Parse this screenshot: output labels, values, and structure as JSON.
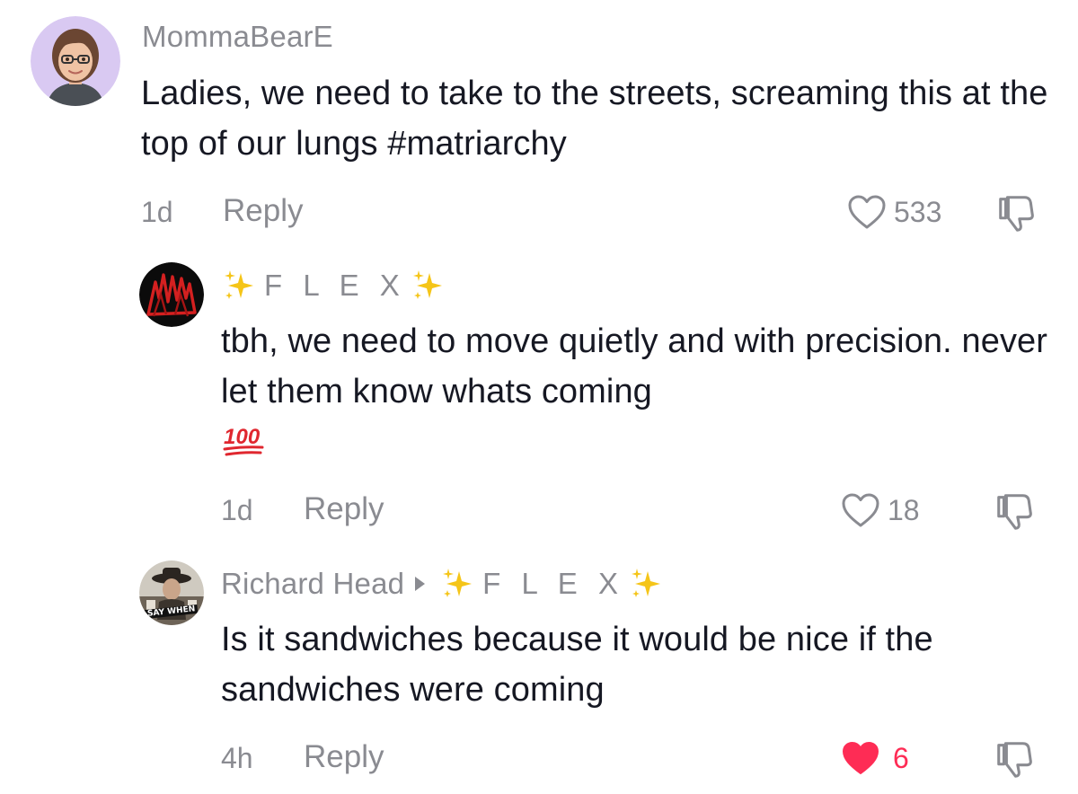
{
  "comments": [
    {
      "username": "MommaBearE",
      "text": "Ladies, we need to take to the streets, screaming this at the top of our lungs #matriarchy",
      "time": "1d",
      "reply_label": "Reply",
      "likes": "533",
      "liked": false
    },
    {
      "username": "F L E X",
      "text": "tbh, we need to move quietly and with precision. never let them know whats coming",
      "emoji": "hundred-points-emoji",
      "time": "1d",
      "reply_label": "Reply",
      "likes": "18",
      "liked": false
    },
    {
      "username": "Richard Head",
      "reply_to": "F L E X",
      "text": "Is it sandwiches because it would be nice if the sandwiches were coming",
      "avatar_caption": "SAY WHEN",
      "time": "4h",
      "reply_label": "Reply",
      "likes": "6",
      "liked": true
    }
  ],
  "colors": {
    "text": "#161823",
    "muted": "#8a8b91",
    "like_active": "#fe2c55",
    "sparkle": "#f5c518"
  }
}
